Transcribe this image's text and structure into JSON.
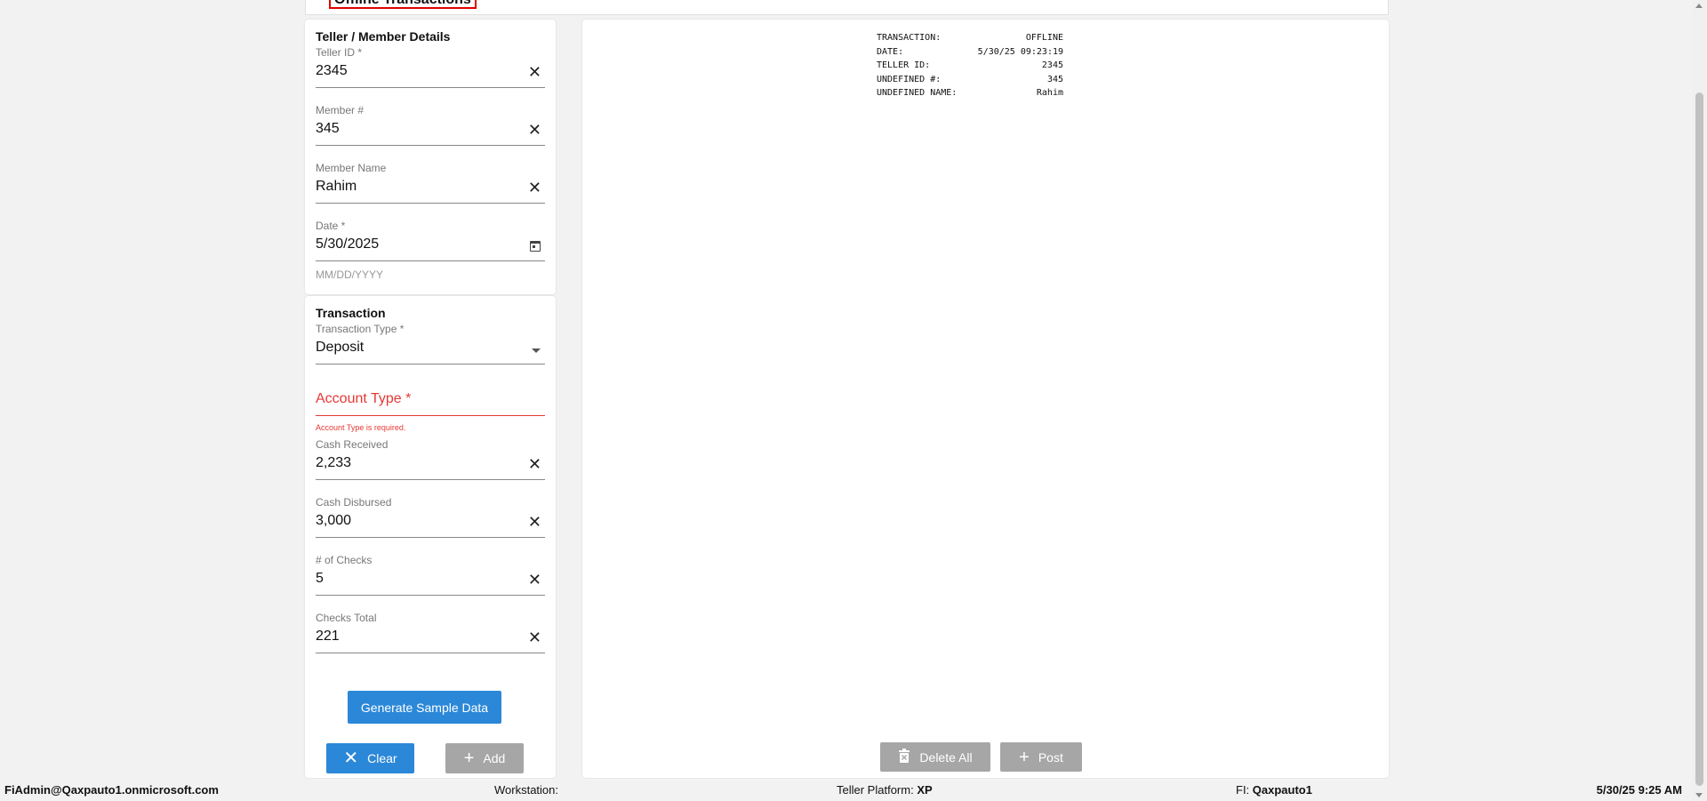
{
  "page_title": "Offline Transactions",
  "teller_section": {
    "title": "Teller / Member Details",
    "teller_id": {
      "label": "Teller ID *",
      "value": "2345"
    },
    "member_number": {
      "label": "Member #",
      "value": "345"
    },
    "member_name": {
      "label": "Member Name",
      "value": "Rahim"
    },
    "date": {
      "label": "Date *",
      "value": "5/30/2025",
      "helper": "MM/DD/YYYY"
    }
  },
  "transaction_section": {
    "title": "Transaction",
    "transaction_type": {
      "label": "Transaction Type *",
      "value": "Deposit"
    },
    "account_type": {
      "label": "Account Type *",
      "error": "Account Type is required."
    },
    "cash_received": {
      "label": "Cash Received",
      "value": "2,233"
    },
    "cash_disbursed": {
      "label": "Cash Disbursed",
      "value": "3,000"
    },
    "num_checks": {
      "label": "# of Checks",
      "value": "5"
    },
    "checks_total": {
      "label": "Checks Total",
      "value": "221"
    }
  },
  "buttons": {
    "generate": "Generate Sample Data",
    "clear": "Clear",
    "add": "Add",
    "delete_all": "Delete All",
    "post": "Post"
  },
  "receipt": [
    {
      "label": "TRANSACTION:",
      "value": "OFFLINE"
    },
    {
      "label": "DATE:",
      "value": "5/30/25 09:23:19"
    },
    {
      "label": "TELLER ID:",
      "value": "2345"
    },
    {
      "label": "UNDEFINED #:",
      "value": "345"
    },
    {
      "label": "UNDEFINED NAME:",
      "value": "Rahim"
    }
  ],
  "status_bar": {
    "user": "FiAdmin@Qaxpauto1.onmicrosoft.com",
    "workstation_label": "Workstation:",
    "workstation_value": "",
    "platform_label": "Teller Platform:",
    "platform_value": "XP",
    "fi_label": "FI:",
    "fi_value": "Qaxpauto1",
    "datetime": "5/30/25 9:25 AM"
  },
  "colors": {
    "accent": "#2b88d8",
    "error": "#e53935",
    "disabled": "#a6a6a6"
  },
  "icons": {
    "clear": "close-icon",
    "calendar": "calendar-icon",
    "dropdown": "chevron-down-icon",
    "delete": "trash-icon",
    "add": "plus-icon"
  }
}
